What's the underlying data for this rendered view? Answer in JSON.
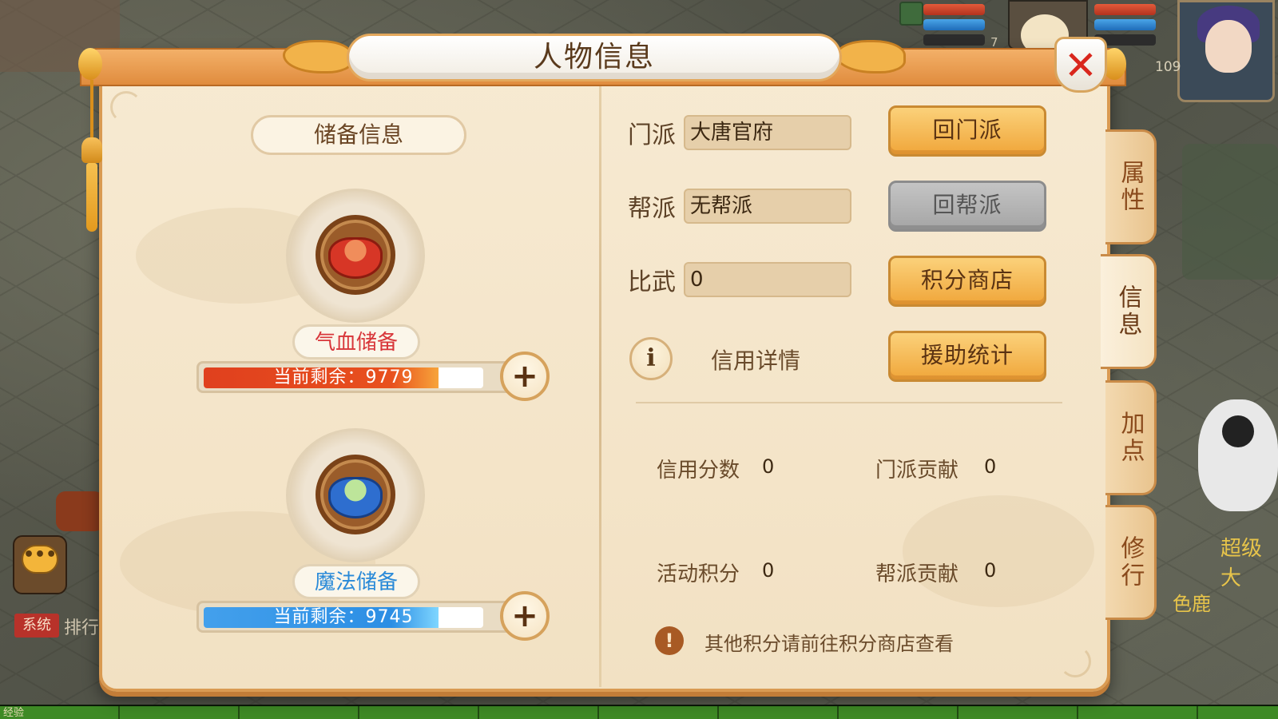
{
  "window": {
    "title": "人物信息",
    "close_glyph": "✕"
  },
  "hud": {
    "player_level": "109",
    "pet_level": "7"
  },
  "chat": {
    "system_tag": "系统",
    "system_text": "排行",
    "chat_glyph": "•••",
    "exp_label": "经验"
  },
  "scene": {
    "side_text_1": "超级大",
    "side_text_2": "色鹿"
  },
  "side_tabs": [
    {
      "label": "属性",
      "active": false
    },
    {
      "label": "信息",
      "active": true
    },
    {
      "label": "加点",
      "active": false
    },
    {
      "label": "修行",
      "active": false
    }
  ],
  "reserve": {
    "title": "储备信息",
    "hp": {
      "label": "气血储备",
      "remaining_text": "当前剩余：9779",
      "value": 9779,
      "icon": "red-bowl-icon",
      "fill_fraction": 0.84
    },
    "mp": {
      "label": "魔法储备",
      "remaining_text": "当前剩余：9745",
      "value": 9745,
      "icon": "blue-bowl-icon",
      "fill_fraction": 0.84
    },
    "add_glyph": "+"
  },
  "info": {
    "sect_label": "门派",
    "sect_value": "大唐官府",
    "sect_button": "回门派",
    "gang_label": "帮派",
    "gang_value": "无帮派",
    "gang_button": "回帮派",
    "pk_label": "比武",
    "pk_value": "0",
    "shop_button": "积分商店",
    "credit_glyph": "i",
    "credit_link": "信用详情",
    "assist_button": "援助统计"
  },
  "stats": {
    "credit_label": "信用分数",
    "credit_value": "0",
    "sect_contrib_label": "门派贡献",
    "sect_contrib_value": "0",
    "activity_label": "活动积分",
    "activity_value": "0",
    "gang_contrib_label": "帮派贡献",
    "gang_contrib_value": "0"
  },
  "notice": {
    "glyph": "!",
    "text": "其他积分请前往积分商店查看"
  },
  "colors": {
    "panel_bg": "#f7ead2",
    "accent": "#f0a63a",
    "hp_bar": "#e0401e",
    "mp_bar": "#2c8ee4",
    "close_x": "#d9261c"
  }
}
